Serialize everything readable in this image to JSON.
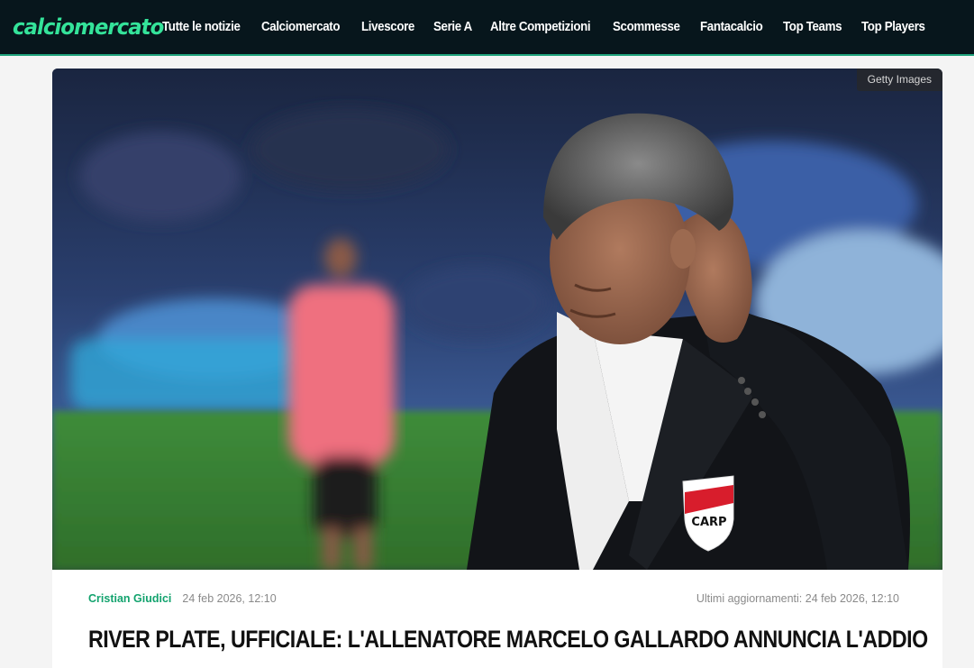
{
  "header": {
    "logo_text": "calciomercato",
    "nav": [
      "Tutte le notizie",
      "Calciomercato",
      "Livescore",
      "Serie A",
      "Altre Competizioni",
      "Scommesse",
      "Fantacalcio",
      "Top Teams",
      "Top Players"
    ]
  },
  "hero": {
    "credit": "Getty Images",
    "badge_text": "CARP"
  },
  "article": {
    "author": "Cristian Giudici",
    "date": "24 feb 2026, 12:10",
    "updated": "Ultimi aggiornamenti: 24 feb 2026, 12:10",
    "title": "RIVER PLATE, UFFICIALE: L'ALLENATORE MARCELO GALLARDO ANNUNCIA L'ADDIO"
  },
  "colors": {
    "header_bg": "#07161c",
    "brand_green": "#34e39a",
    "author_green": "#13a36e"
  }
}
